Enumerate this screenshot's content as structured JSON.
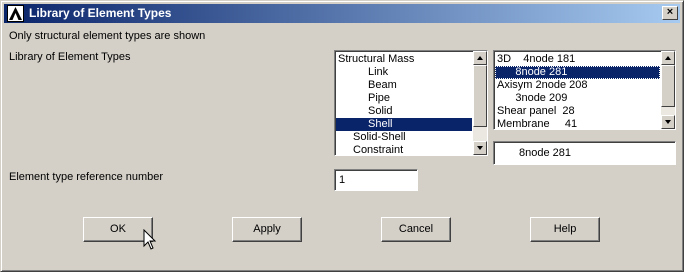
{
  "window": {
    "title": "Library of Element Types",
    "app_icon": "ansys-logo-icon",
    "close_label": "×"
  },
  "info_text": "Only structural element types are shown",
  "library_label": "Library of Element Types",
  "category_list": {
    "items": [
      {
        "label": "Structural Mass",
        "indent": 0,
        "selected": false
      },
      {
        "label": "Link",
        "indent": 2,
        "selected": false
      },
      {
        "label": "Beam",
        "indent": 2,
        "selected": false
      },
      {
        "label": "Pipe",
        "indent": 2,
        "selected": false
      },
      {
        "label": "Solid",
        "indent": 2,
        "selected": false
      },
      {
        "label": "Shell",
        "indent": 2,
        "selected": true
      },
      {
        "label": "Solid-Shell",
        "indent": 1,
        "selected": false
      },
      {
        "label": "Constraint",
        "indent": 1,
        "selected": false
      }
    ]
  },
  "element_list": {
    "items": [
      {
        "label": "3D    4node 181",
        "selected": false
      },
      {
        "label": "      8node 281",
        "selected": true
      },
      {
        "label": "Axisym 2node 208",
        "selected": false
      },
      {
        "label": "      3node 209",
        "selected": false
      },
      {
        "label": "Shear panel  28",
        "selected": false
      },
      {
        "label": "Membrane     41",
        "selected": false
      }
    ]
  },
  "selected_element": "8node 281",
  "ref_number_label": "Element type reference number",
  "ref_number_value": "1",
  "buttons": {
    "ok": "OK",
    "apply": "Apply",
    "cancel": "Cancel",
    "help": "Help"
  }
}
